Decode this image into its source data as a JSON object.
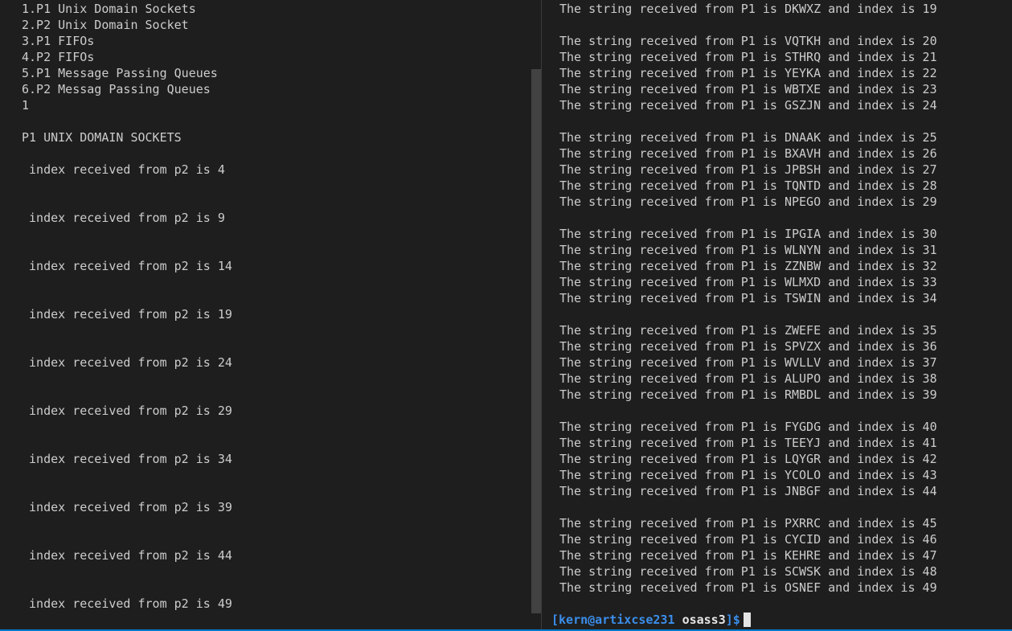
{
  "left_terminal": {
    "lines": [
      "1.P1 Unix Domain Sockets",
      "2.P2 Unix Domain Socket",
      "3.P1 FIFOs",
      "4.P2 FIFOs",
      "5.P1 Message Passing Queues",
      "6.P2 Messag Passing Queues",
      "1",
      "",
      "P1 UNIX DOMAIN SOCKETS",
      "",
      " index received from p2 is 4",
      "",
      "",
      " index received from p2 is 9",
      "",
      "",
      " index received from p2 is 14",
      "",
      "",
      " index received from p2 is 19",
      "",
      "",
      " index received from p2 is 24",
      "",
      "",
      " index received from p2 is 29",
      "",
      "",
      " index received from p2 is 34",
      "",
      "",
      " index received from p2 is 39",
      "",
      "",
      " index received from p2 is 44",
      "",
      "",
      " index received from p2 is 49"
    ]
  },
  "right_terminal": {
    "lines": [
      "The string received from P1 is DKWXZ and index is 19",
      "",
      "The string received from P1 is VQTKH and index is 20",
      "The string received from P1 is STHRQ and index is 21",
      "The string received from P1 is YEYKA and index is 22",
      "The string received from P1 is WBTXE and index is 23",
      "The string received from P1 is GSZJN and index is 24",
      "",
      "The string received from P1 is DNAAK and index is 25",
      "The string received from P1 is BXAVH and index is 26",
      "The string received from P1 is JPBSH and index is 27",
      "The string received from P1 is TQNTD and index is 28",
      "The string received from P1 is NPEGO and index is 29",
      "",
      "The string received from P1 is IPGIA and index is 30",
      "The string received from P1 is WLNYN and index is 31",
      "The string received from P1 is ZZNBW and index is 32",
      "The string received from P1 is WLMXD and index is 33",
      "The string received from P1 is TSWIN and index is 34",
      "",
      "The string received from P1 is ZWEFE and index is 35",
      "The string received from P1 is SPVZX and index is 36",
      "The string received from P1 is WVLLV and index is 37",
      "The string received from P1 is ALUPO and index is 38",
      "The string received from P1 is RMBDL and index is 39",
      "",
      "The string received from P1 is FYGDG and index is 40",
      "The string received from P1 is TEEYJ and index is 41",
      "The string received from P1 is LQYGR and index is 42",
      "The string received from P1 is YCOLO and index is 43",
      "The string received from P1 is JNBGF and index is 44",
      "",
      "The string received from P1 is PXRRC and index is 45",
      "The string received from P1 is CYCID and index is 46",
      "The string received from P1 is KEHRE and index is 47",
      "The string received from P1 is SCWSK and index is 48",
      "The string received from P1 is OSNEF and index is 49"
    ],
    "prompt": {
      "open_bracket": "[",
      "user_host": "kern@artixcse231",
      "directory": "osass3",
      "close_bracket": "]",
      "symbol": "$"
    }
  },
  "colors": {
    "background": "#1e1e1e",
    "text": "#cccccc",
    "prompt_accent": "#3b8eea",
    "scrollbar": "#424242",
    "status_strip": "#007acc"
  }
}
